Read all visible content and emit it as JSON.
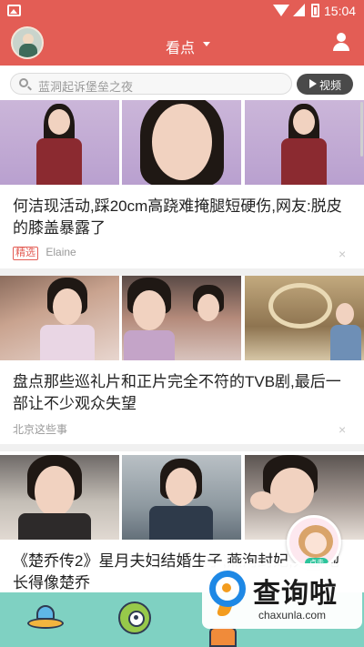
{
  "status_bar": {
    "time": "15:04",
    "icons": [
      "gallery-icon",
      "wifi-icon",
      "signal-icon",
      "battery-icon"
    ]
  },
  "header": {
    "title": "看点",
    "left_icon": "avatar",
    "right_icon": "user-icon",
    "background": "#e35d55"
  },
  "search": {
    "placeholder": "蓝洞起诉堡垒之夜",
    "video_button": "视频"
  },
  "feed": [
    {
      "headline": "何洁现活动,踩20cm高跷难掩腿短硬伤,网友:脱皮的膝盖暴露了",
      "tag": "精选",
      "source": "Elaine",
      "close": "×"
    },
    {
      "headline": "盘点那些巡礼片和正片完全不符的TVB剧,最后一部让不少观众失望",
      "source": "北京这些事",
      "close": "×"
    },
    {
      "headline": "《楚乔传2》星月夫妇结婚生子,燕洵封妃,只因她长得像楚乔"
    }
  ],
  "promo": {
    "badge": "点击"
  },
  "watermark": {
    "text": "查询啦",
    "url": "chaxunla.com"
  },
  "colors": {
    "accent": "#e35d55",
    "tag": "#e35d55",
    "bottom_nav": "#7fd1c2"
  }
}
